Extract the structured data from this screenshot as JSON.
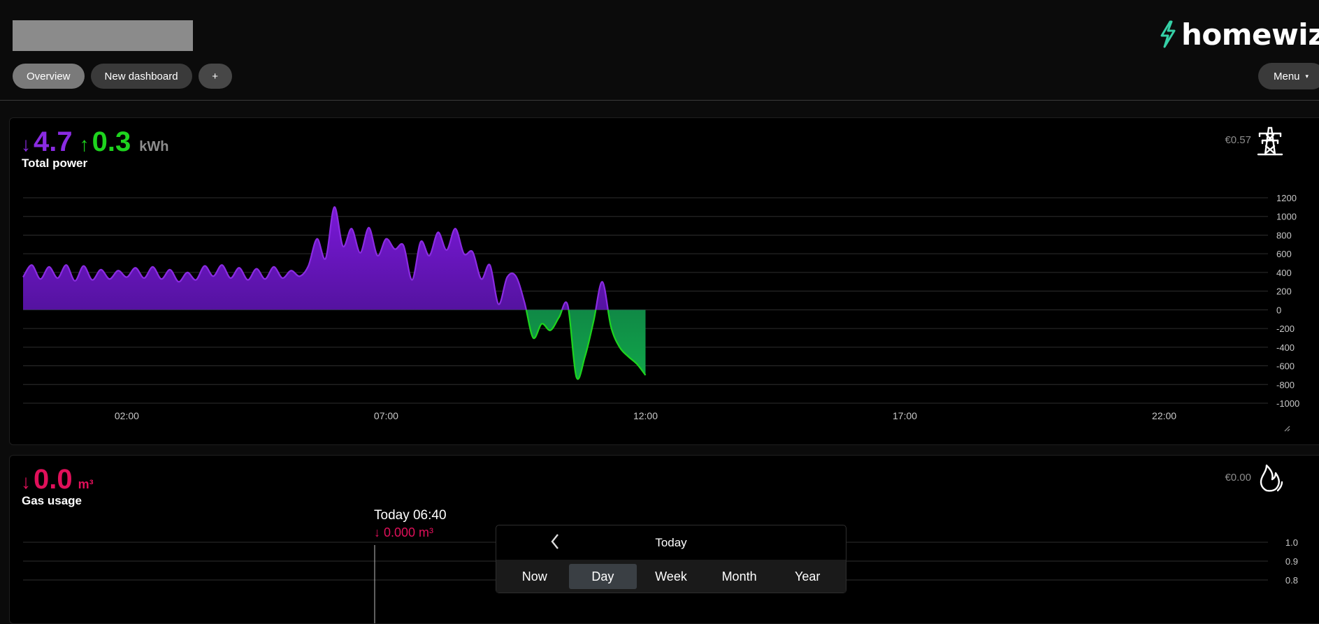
{
  "header": {
    "logo_text": "homewizard",
    "logo_color": "#35d0a6",
    "tabs": [
      {
        "label": "Overview",
        "active": true
      },
      {
        "label": "New dashboard",
        "active": false
      },
      {
        "label": "+",
        "active": false
      }
    ],
    "menu_label": "Menu",
    "menu_caret": "▾"
  },
  "power_card": {
    "import_arrow": "↓",
    "import_value": "4.7",
    "export_arrow": "↑",
    "export_value": "0.3",
    "unit": "kWh",
    "label": "Total power",
    "price": "€0.57",
    "icon": "power-pylon-icon",
    "import_color": "#8a2be2",
    "export_color": "#1ed41e"
  },
  "gas_card": {
    "arrow": "↓",
    "value": "0.0",
    "unit": "m³",
    "label": "Gas usage",
    "price": "€0.00",
    "icon": "flame-icon",
    "color": "#e0105a",
    "tooltip_time": "Today 06:40",
    "tooltip_value": "↓ 0.000 m³"
  },
  "chart_data": [
    {
      "type": "area",
      "title": "Total power",
      "xlabel": "",
      "ylabel": "",
      "x_ticks": [
        "02:00",
        "07:00",
        "12:00",
        "17:00",
        "22:00"
      ],
      "y_ticks": [
        1200,
        1000,
        800,
        600,
        400,
        200,
        0,
        -200,
        -400,
        -600,
        -800,
        -1000
      ],
      "xlim": [
        "00:00",
        "24:00"
      ],
      "ylim": [
        -1000,
        1200
      ],
      "grid": true,
      "series": [
        {
          "color_positive": "#8a2be2",
          "color_negative": "#1ed41e",
          "x": [
            "00:00",
            "00:10",
            "00:20",
            "00:30",
            "00:40",
            "00:50",
            "01:00",
            "01:10",
            "01:20",
            "01:30",
            "01:40",
            "01:50",
            "02:00",
            "02:10",
            "02:20",
            "02:30",
            "02:40",
            "02:50",
            "03:00",
            "03:10",
            "03:20",
            "03:30",
            "03:40",
            "03:50",
            "04:00",
            "04:10",
            "04:20",
            "04:30",
            "04:40",
            "04:50",
            "05:00",
            "05:10",
            "05:20",
            "05:30",
            "05:40",
            "05:50",
            "06:00",
            "06:10",
            "06:20",
            "06:30",
            "06:40",
            "06:50",
            "07:00",
            "07:10",
            "07:20",
            "07:30",
            "07:40",
            "07:50",
            "08:00",
            "08:10",
            "08:20",
            "08:30",
            "08:40",
            "08:50",
            "09:00",
            "09:10",
            "09:20",
            "09:30",
            "09:40",
            "09:50",
            "10:00",
            "10:10",
            "10:20",
            "10:30",
            "10:40",
            "10:50",
            "11:00",
            "11:10",
            "11:20",
            "11:30",
            "11:40",
            "11:50",
            "12:00"
          ],
          "values": [
            350,
            480,
            330,
            460,
            340,
            480,
            310,
            470,
            320,
            430,
            330,
            420,
            350,
            450,
            340,
            460,
            330,
            430,
            300,
            400,
            320,
            470,
            360,
            480,
            340,
            450,
            320,
            440,
            330,
            460,
            340,
            420,
            360,
            470,
            760,
            550,
            1100,
            680,
            870,
            610,
            880,
            580,
            760,
            650,
            690,
            320,
            730,
            580,
            830,
            640,
            870,
            600,
            620,
            330,
            480,
            60,
            350,
            360,
            80,
            -300,
            -150,
            -220,
            -80,
            50,
            -720,
            -500,
            -120,
            300,
            -180,
            -400,
            -500,
            -580,
            -700
          ]
        }
      ]
    },
    {
      "type": "line",
      "title": "Gas usage",
      "xlabel": "",
      "ylabel": "",
      "y_ticks": [
        1.0,
        0.9,
        0.8
      ],
      "grid": true,
      "series": []
    }
  ],
  "timebar": {
    "back_icon": "chevron-left-icon",
    "label": "Today",
    "periods": [
      {
        "label": "Now",
        "active": false
      },
      {
        "label": "Day",
        "active": true
      },
      {
        "label": "Week",
        "active": false
      },
      {
        "label": "Month",
        "active": false
      },
      {
        "label": "Year",
        "active": false
      }
    ]
  }
}
